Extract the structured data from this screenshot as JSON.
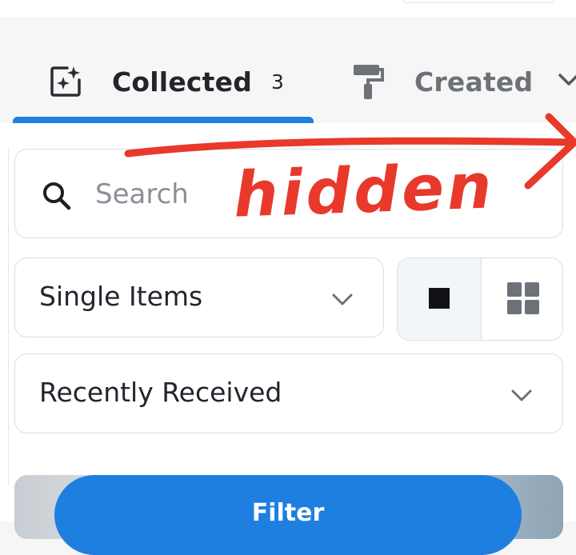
{
  "tabs": {
    "collected": {
      "label": "Collected",
      "count": "3",
      "active": true,
      "icon": "sparkle-square-icon"
    },
    "created": {
      "label": "Created",
      "icon": "paint-roller-icon"
    },
    "more_icon": "chevron-down-icon",
    "accent_color": "#1f7fe0"
  },
  "search": {
    "placeholder": "Search",
    "value": "",
    "icon": "search-icon"
  },
  "filters": {
    "item_type": {
      "selected": "Single Items",
      "icon": "chevron-down-icon"
    },
    "sort": {
      "selected": "Recently Received",
      "icon": "chevron-down-icon"
    },
    "view_toggle": {
      "options": [
        {
          "name": "single-view",
          "icon": "single-square-icon",
          "selected": true
        },
        {
          "name": "grid-view",
          "icon": "grid-icon",
          "selected": false
        }
      ]
    }
  },
  "filter_button": {
    "label": "Filter",
    "color": "#1f7fe0"
  },
  "annotation": {
    "text": "hidden",
    "color": "#e8392b"
  }
}
